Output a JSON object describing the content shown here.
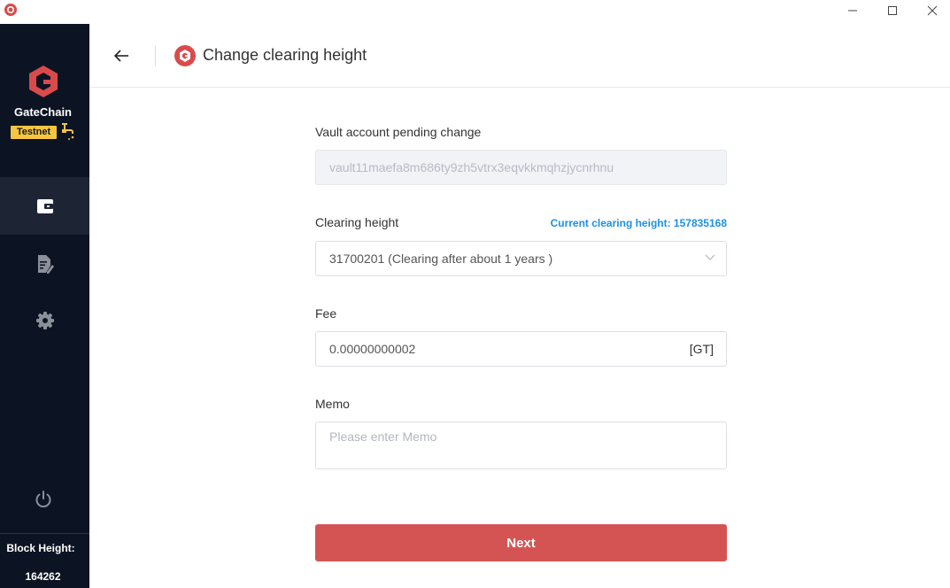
{
  "window": {
    "icon": "gatechain-app-icon",
    "controls": [
      "minimize-icon",
      "maximize-icon",
      "close-icon"
    ]
  },
  "sidebar": {
    "brand": "GateChain",
    "badge": "Testnet",
    "nav": [
      {
        "name": "wallet",
        "icon": "wallet-icon",
        "active": true
      },
      {
        "name": "records",
        "icon": "edit-document-icon",
        "active": false
      },
      {
        "name": "settings",
        "icon": "gear-icon",
        "active": false
      }
    ],
    "power_icon": "power-icon",
    "block_height_label": "Block Height:",
    "block_height_value": "164262"
  },
  "header": {
    "title": "Change clearing height"
  },
  "form": {
    "vault_label": "Vault account pending change",
    "vault_value": "vault11maefa8m686ty9zh5vtrx3eqvkkmqhzjycnrhnu",
    "clearing_label": "Clearing height",
    "current_clearing": "Current clearing height: 157835168",
    "clearing_value": "31700201 (Clearing after about 1 years )",
    "fee_label": "Fee",
    "fee_value": "0.00000000002",
    "fee_unit": "[GT]",
    "memo_label": "Memo",
    "memo_placeholder": "Please enter Memo",
    "next_button": "Next"
  },
  "colors": {
    "sidebar_bg": "#0c1423",
    "brand_red": "#d45454",
    "badge_yellow": "#f5c542",
    "link_blue": "#1e90e0"
  }
}
